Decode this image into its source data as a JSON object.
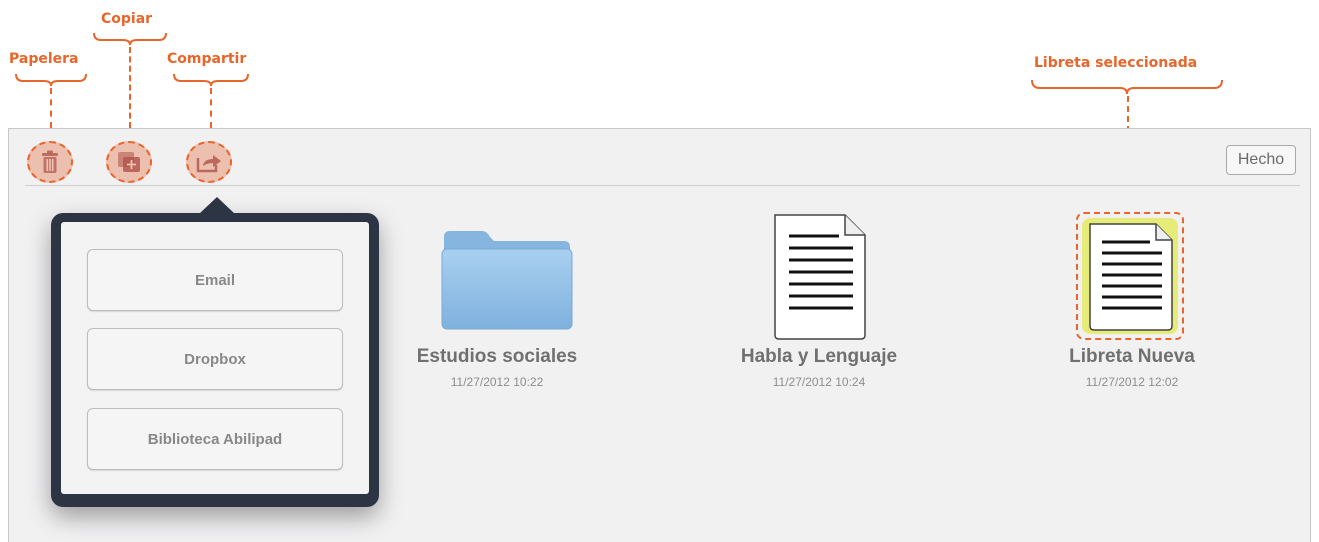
{
  "annotations": {
    "trash": "Papelera",
    "copy": "Copiar",
    "share": "Compartir",
    "selected": "Libreta seleccionada"
  },
  "toolbar": {
    "done_label": "Hecho"
  },
  "share_menu": {
    "options": [
      "Email",
      "Dropbox",
      "Biblioteca Abilipad"
    ]
  },
  "documents": [
    {
      "type": "folder",
      "title": "Estudios sociales",
      "date": "11/27/2012 10:22"
    },
    {
      "type": "notebook",
      "title": "Habla y Lenguaje",
      "date": "11/27/2012 10:24"
    },
    {
      "type": "notebook",
      "title": "Libreta Nueva",
      "date": "11/27/2012 12:02",
      "selected": true
    }
  ],
  "colors": {
    "annotation": "#e8652b",
    "folder": "#8fbde5",
    "selection_glow": "#e6eb6b",
    "popover": "#2d3545"
  },
  "icons": [
    "trash-icon",
    "copy-icon",
    "share-icon",
    "folder-icon",
    "notebook-icon"
  ]
}
